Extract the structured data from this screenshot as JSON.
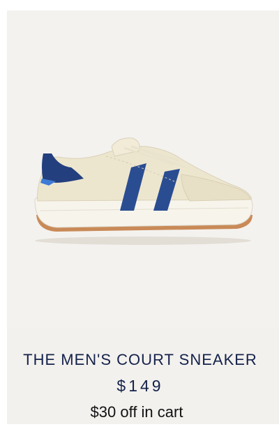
{
  "product": {
    "name": "THE MEN'S COURT SNEAKER",
    "price": "$149",
    "promo": "$30 off in cart",
    "image_icon": "sneaker-product-image",
    "colors": {
      "background": "#f3f1ee",
      "upper": "#ede6cf",
      "stripe": "#2a4d92",
      "heel_tab": "#233f7e",
      "sole": "#f7f4ec",
      "outsole": "#c98a57",
      "text": "#14224a"
    }
  }
}
